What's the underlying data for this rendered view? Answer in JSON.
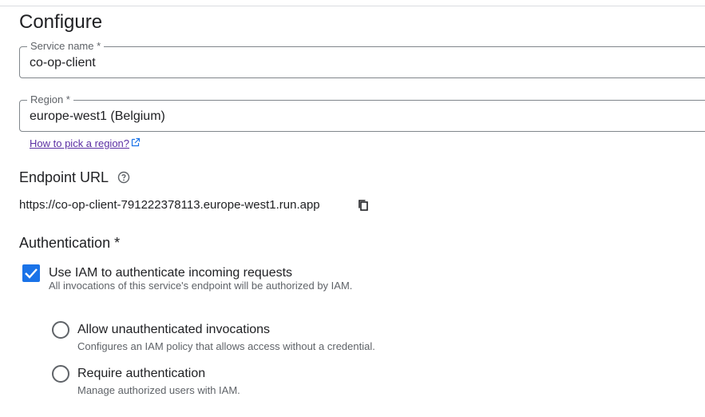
{
  "page": {
    "title": "Configure"
  },
  "service_name": {
    "label": "Service name *",
    "value": "co-op-client"
  },
  "region": {
    "label": "Region *",
    "value": "europe-west1 (Belgium)",
    "help_link": "How to pick a region?"
  },
  "endpoint": {
    "heading": "Endpoint URL",
    "url": "https://co-op-client-791222378113.europe-west1.run.app"
  },
  "authentication": {
    "heading": "Authentication *",
    "use_iam": {
      "label": "Use IAM to authenticate incoming requests",
      "description": "All invocations of this service's endpoint will be authorized by IAM.",
      "checked": true
    },
    "options": [
      {
        "label": "Allow unauthenticated invocations",
        "description": "Configures an IAM policy that allows access without a credential.",
        "selected": false
      },
      {
        "label": "Require authentication",
        "description": "Manage authorized users with IAM.",
        "selected": false
      }
    ]
  },
  "colors": {
    "accent": "#1a73e8",
    "link": "#5b2fa3",
    "text": "#202124",
    "secondary_text": "#5f6368",
    "border": "#80868b"
  },
  "icons": [
    "external-link-icon",
    "help-icon",
    "copy-icon",
    "check-icon",
    "chevron-down-icon"
  ]
}
